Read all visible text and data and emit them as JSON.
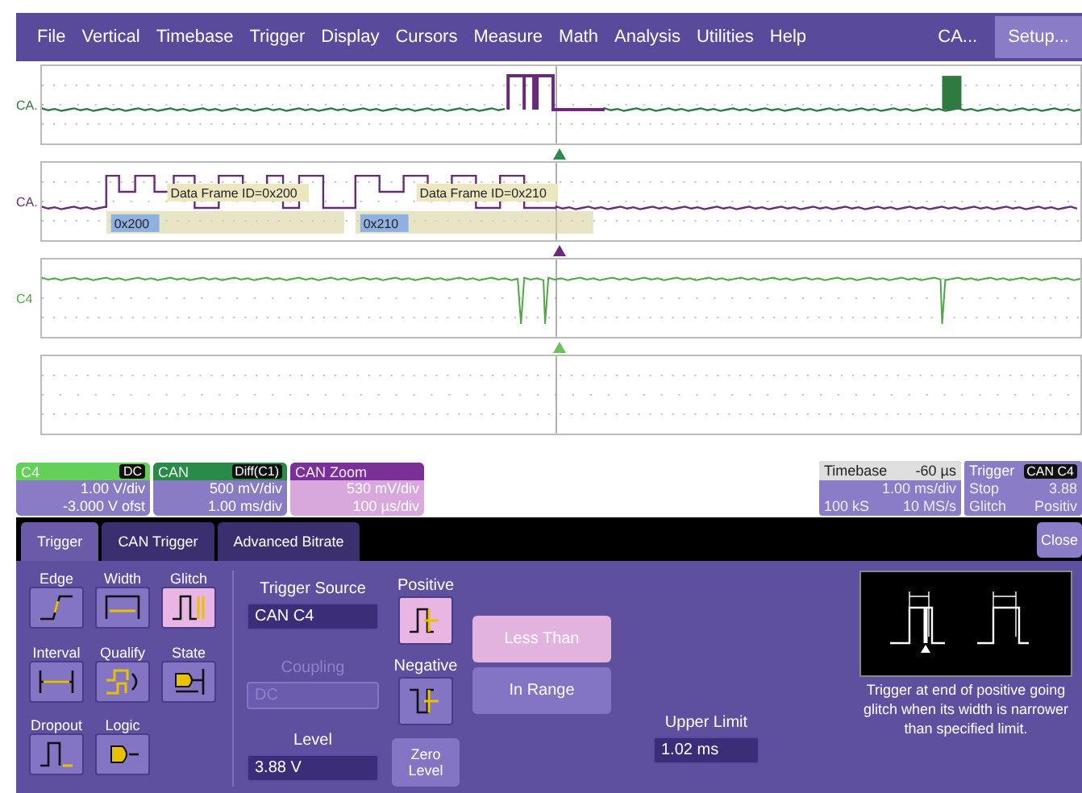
{
  "menu": {
    "items": [
      "File",
      "Vertical",
      "Timebase",
      "Trigger",
      "Display",
      "Cursors",
      "Measure",
      "Math",
      "Analysis",
      "Utilities",
      "Help"
    ],
    "channel_shortcut": "CA...",
    "setup_button": "Setup..."
  },
  "grids": [
    {
      "label": "CA.",
      "color": "#2f7a3f",
      "kind": "bus-overview",
      "marker": {
        "color": "#2f8a4a"
      }
    },
    {
      "label": "CA.",
      "color": "#6a2a7a",
      "kind": "bus-decoded",
      "marker": {
        "color": "#6a2a7a"
      },
      "frames": [
        {
          "title": "Data Frame ID=0x200",
          "id": "0x200"
        },
        {
          "title": "Data Frame ID=0x210",
          "id": "0x210"
        }
      ]
    },
    {
      "label": "C4",
      "color": "#4fa844",
      "kind": "glitch",
      "marker": {
        "color": "#6cc060"
      }
    },
    {
      "kind": "empty"
    }
  ],
  "descriptors": [
    {
      "title": "C4",
      "badge": "DC",
      "color": "#63d05a",
      "selected": false,
      "lines": [
        "1.00 V/div",
        "-3.000 V ofst"
      ]
    },
    {
      "title": "CAN",
      "badge": "Diff(C1)",
      "color": "#2a8a4a",
      "selected": false,
      "lines": [
        "500 mV/div",
        "1.00 ms/div"
      ]
    },
    {
      "title": "CAN Zoom",
      "color": "#7a3096",
      "selected": true,
      "lines": [
        "530 mV/div",
        "100 µs/div"
      ]
    }
  ],
  "timebase": {
    "title": "Timebase",
    "delay": "-60 µs",
    "scale": "1.00 ms/div",
    "samples": "100 kS",
    "rate": "10 MS/s"
  },
  "trigger_readout": {
    "title": "Trigger",
    "source": "CAN C4",
    "mode": "Stop",
    "level": "3.88",
    "type": "Glitch",
    "slope": "Positiv"
  },
  "dialog": {
    "tabs": [
      {
        "label": "Trigger",
        "selected": true
      },
      {
        "label": "CAN Trigger",
        "selected": false
      },
      {
        "label": "Advanced Bitrate",
        "selected": false
      }
    ],
    "close_button": "Close",
    "trigger_types": [
      {
        "label": "Edge",
        "kind": "edge",
        "selected": false
      },
      {
        "label": "Width",
        "kind": "width",
        "selected": false
      },
      {
        "label": "Glitch",
        "kind": "glitch",
        "selected": true
      },
      {
        "label": "Interval",
        "kind": "interval",
        "selected": false
      },
      {
        "label": "Qualify",
        "kind": "qualify",
        "selected": false
      },
      {
        "label": "State",
        "kind": "state",
        "selected": false
      },
      {
        "label": "Dropout",
        "kind": "dropout",
        "selected": false
      },
      {
        "label": "Logic",
        "kind": "logic",
        "selected": false
      }
    ],
    "source": {
      "label": "Trigger Source",
      "value": "CAN C4"
    },
    "coupling": {
      "label": "Coupling",
      "value": "DC",
      "disabled": true
    },
    "level": {
      "label": "Level",
      "value": "3.88 V"
    },
    "zero_level_button": "Zero Level",
    "slopes": [
      {
        "label": "Positive",
        "kind": "positive",
        "selected": true
      },
      {
        "label": "Negative",
        "kind": "negative",
        "selected": false
      }
    ],
    "conditions": [
      {
        "label": "Less Than",
        "selected": true
      },
      {
        "label": "In Range",
        "selected": false
      }
    ],
    "upper_limit": {
      "label": "Upper Limit",
      "value": "1.02 ms"
    },
    "description": "Trigger at end of positive going glitch when its width is narrower than specified limit."
  }
}
